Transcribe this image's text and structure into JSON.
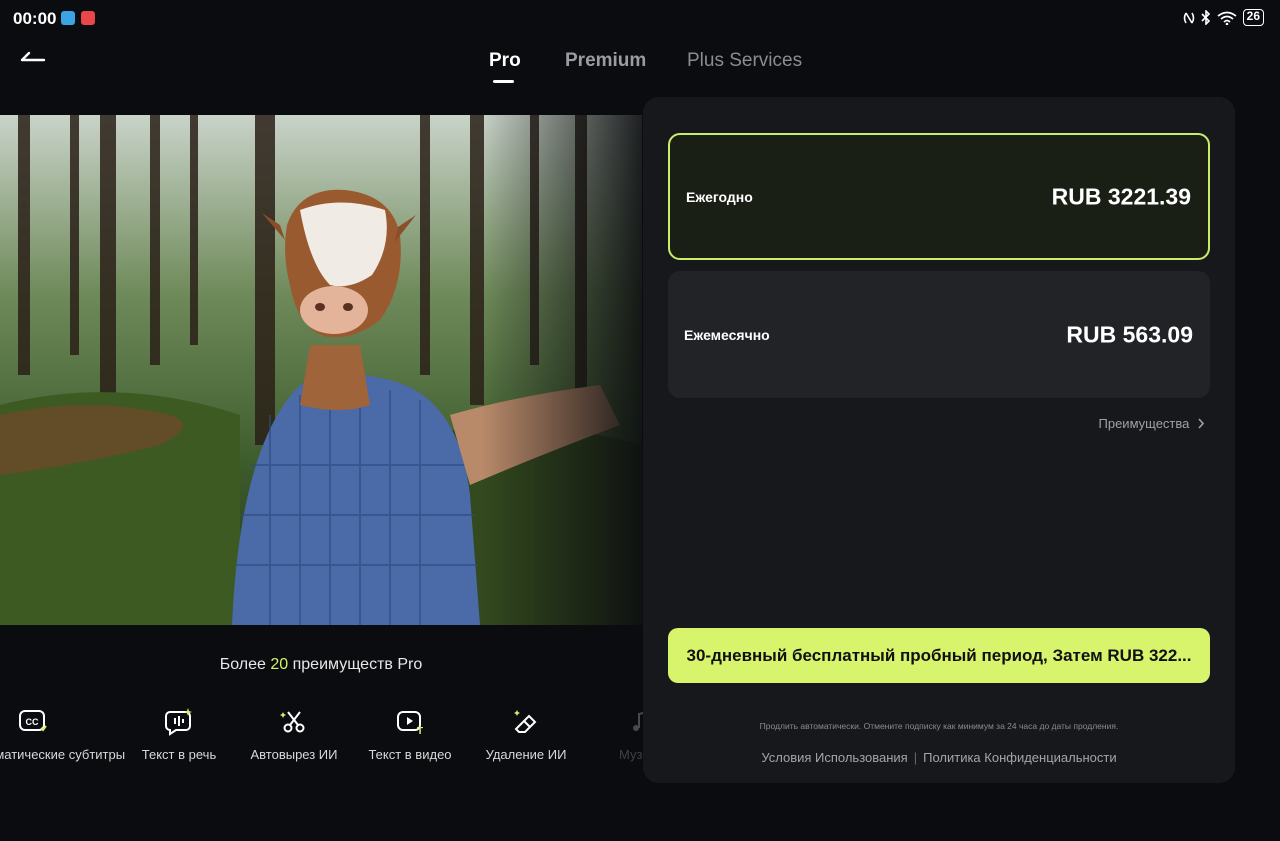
{
  "status_bar": {
    "time": "00:00",
    "battery": "26"
  },
  "header": {
    "tabs": [
      {
        "label": "Pro",
        "active": true
      },
      {
        "label": "Premium",
        "active": false
      },
      {
        "label": "Plus Services",
        "active": false
      }
    ]
  },
  "features": {
    "title_prefix": "Более ",
    "title_count": "20",
    "title_suffix": " преимуществ Pro",
    "items": [
      {
        "label": "Автоматические субтитры",
        "icon": "captions-icon"
      },
      {
        "label": "Текст в речь",
        "icon": "text-to-speech-icon"
      },
      {
        "label": "Автовырез ИИ",
        "icon": "scissors-icon"
      },
      {
        "label": "Текст в видео",
        "icon": "text-to-video-icon"
      },
      {
        "label": "Удаление ИИ",
        "icon": "eraser-icon"
      },
      {
        "label": "Музыка",
        "icon": "music-icon"
      }
    ]
  },
  "plans": [
    {
      "name": "Ежегодно",
      "price": "RUB 3221.39",
      "selected": true
    },
    {
      "name": "Ежемесячно",
      "price": "RUB 563.09",
      "selected": false
    }
  ],
  "benefits_link": "Преимущества",
  "cta": "30-дневный бесплатный пробный период, Затем RUB 322...",
  "auto_renew_note": "Продлить автоматически. Отмените подписку как минимум за 24 часа до даты продления.",
  "legal": {
    "terms": "Условия Использования",
    "separator": "|",
    "privacy": "Политика Конфиденциальности"
  },
  "colors": {
    "accent": "#d8f46d",
    "selected_border": "#c9ef6a",
    "background": "#0b0c0f",
    "panel": "#17181c"
  }
}
